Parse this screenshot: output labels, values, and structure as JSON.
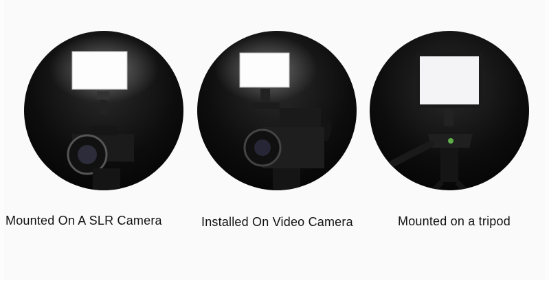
{
  "captions": {
    "slr_camera": "Mounted On A SLR Camera",
    "video_camera": "Installed On Video Camera",
    "tripod": "Mounted on a tripod"
  },
  "colors": {
    "background": "#fafafa",
    "photo_background": "#000000",
    "light_panel": "#ffffff",
    "caption_text": "#111111"
  }
}
